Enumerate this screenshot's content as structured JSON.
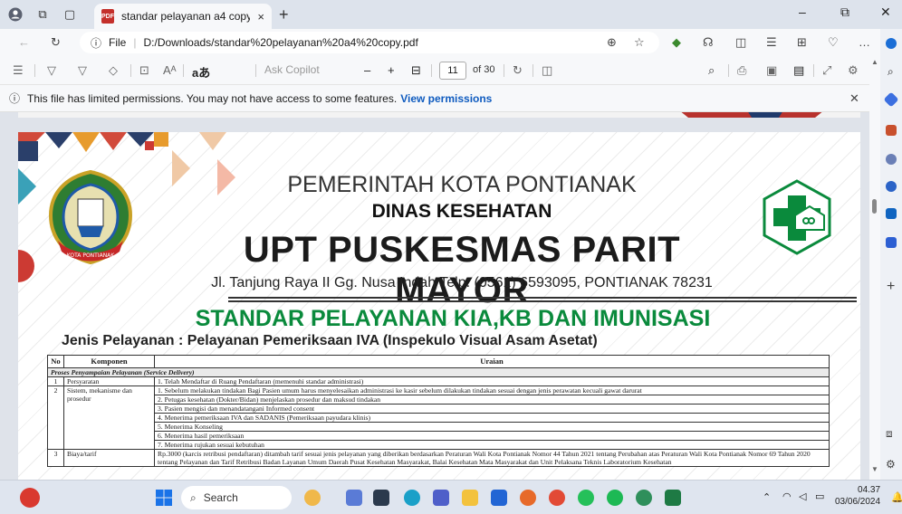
{
  "tab": {
    "title": "standar pelayanan a4 copy.pdf",
    "close": "×",
    "new": "+"
  },
  "window": {
    "minimize": "–",
    "restore": "⧉",
    "close": "✕"
  },
  "address": {
    "scheme_label": "File",
    "url": "D:/Downloads/standar%20pelayanan%20a4%20copy.pdf"
  },
  "pdf_toolbar": {
    "ask_copilot": "Ask Copilot",
    "zoom_out": "–",
    "zoom_in": "+",
    "current_page": "11",
    "page_total": "of 30",
    "read_aloud": "aあ",
    "aa": "Aᴬ"
  },
  "info_bar": {
    "message": "This file has limited permissions. You may not have access to some features.",
    "link": "View permissions",
    "close": "✕"
  },
  "document": {
    "line1": "PEMERINTAH KOTA PONTIANAK",
    "line2": "DINAS KESEHATAN",
    "line3": "UPT PUSKESMAS PARIT MAYOR",
    "address": "Jl. Tanjung Raya II Gg. Nusa Indah Telp. (0561) 6593095, PONTIANAK 78231",
    "heading": "STANDAR PELAYANAN KIA,KB DAN IMUNISASI",
    "subheading": "Jenis Pelayanan : Pelayanan Pemeriksaan IVA (Inspekulo Visual Asam Asetat)",
    "emblem_text": "KOTA PONTIANAK",
    "table": {
      "headers": [
        "No",
        "Komponen",
        "Uraian"
      ],
      "section": "Proses Penyampaian Pelayanan (Service Delivery)",
      "r1": {
        "no": "1",
        "komponen": "Persyaratan",
        "uraian": "1.  Telah Mendaftar di Ruang Pendaftaran (memenuhi standar administrasi)"
      },
      "r2": {
        "no": "2",
        "komponen": "Sistem, mekanisme dan prosedur",
        "items": [
          "1.  Sebelum melakukan tindakan Bagi Pasien umum harus menyelesaikan administrasi ke kasir sebelum dilakukan tindakan sesuai dengan jenis perawatan kecuali gawat darurat",
          "2.  Petugas kesehatan (Dokter/Bidan) menjelaskan prosedur dan maksud tindakan",
          "3.  Pasien mengisi dan menandatangani Informed consent",
          "4.  Menerima pemeriksaan IVA dan SADANIS (Pemeriksaan payudara klinis)",
          "5.  Menerima Konseling",
          "6.  Menerima hasil pemeriksaan",
          "7.  Menerima rujukan sesuai kebutuhan"
        ]
      },
      "r3": {
        "no": "3",
        "komponen": "Biaya/tarif",
        "uraian": "Rp.3000 (karcis retribusi pendaftaran) ditambah tarif sesuai jenis pelayanan yang diberikan berdasarkan Peraturan Wali Kota Pontianak Nomor 44 Tahun 2021 tentang Perubahan atas Peraturan Wali Kota Pontianak Nomor 69 Tahun 2020 tentang Pelayanan dan Tarif Retribusi Badan Layanan Umum Daerah Pusat Kesehatan Masyarakat, Balai Kesehatan Mata Masyarakat dan Unit Pelaksana Teknis Laboratorium Kesehatan"
      }
    }
  },
  "taskbar": {
    "search": "Search",
    "time": "04.37",
    "date": "03/06/2024"
  },
  "colors": {
    "green": "#0a8a3c",
    "link": "#0f5bbf"
  }
}
